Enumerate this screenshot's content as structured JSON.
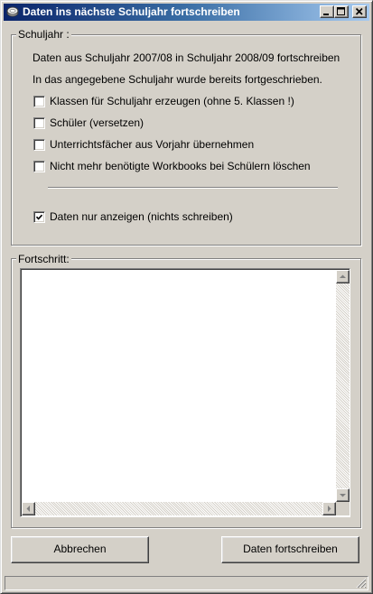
{
  "window": {
    "title": "Daten ins nächste Schuljahr fortschreiben",
    "icon": "app-icon",
    "controls": {
      "minimize": "minimize-icon",
      "maximize": "maximize-icon",
      "close": "close-icon"
    }
  },
  "schuljahr": {
    "group_label": "Schuljahr :",
    "info_line_1": "Daten aus Schuljahr 2007/08 in Schuljahr 2008/09 fortschreiben",
    "info_line_2": "In das angegebene Schuljahr wurde bereits fortgeschrieben.",
    "options": [
      {
        "label": "Klassen für Schuljahr erzeugen (ohne 5. Klassen !)",
        "checked": false
      },
      {
        "label": "Schüler (versetzen)",
        "checked": false
      },
      {
        "label": "Unterrichtsfächer aus Vorjahr übernehmen",
        "checked": false
      },
      {
        "label": "Nicht mehr benötigte Workbooks bei Schülern löschen",
        "checked": false
      }
    ],
    "preview_option": {
      "label": "Daten nur anzeigen (nichts schreiben)",
      "checked": true
    }
  },
  "progress": {
    "group_label": "Fortschritt:",
    "log_text": ""
  },
  "buttons": {
    "cancel_label": "Abbrechen",
    "submit_label": "Daten fortschreiben"
  }
}
